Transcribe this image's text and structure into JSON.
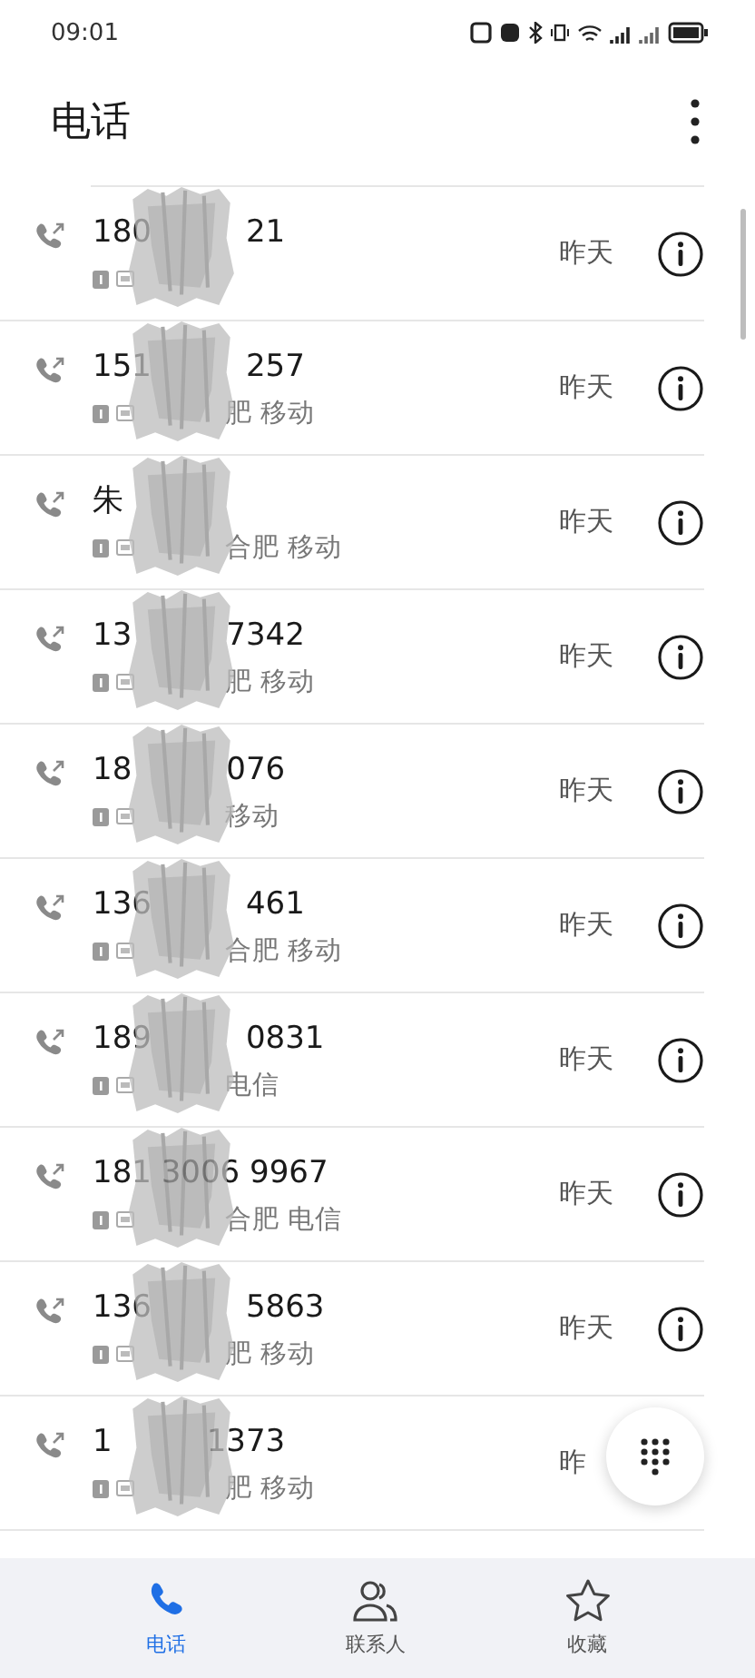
{
  "status_bar": {
    "time": "09:01"
  },
  "header": {
    "title": "电话"
  },
  "calls": [
    {
      "number_start": "180",
      "number_end": "21",
      "date": "昨天",
      "info": true
    },
    {
      "number_start": "151",
      "number_end": "257",
      "location": "肥 移动",
      "date": "昨天",
      "info": true
    },
    {
      "number_start": "朱",
      "location": "合肥 移动",
      "date": "昨天",
      "info": true
    },
    {
      "number_start": "13",
      "number_end": "7342",
      "location": "肥 移动",
      "date": "昨天",
      "info": true
    },
    {
      "number_start": "18",
      "number_end": "076",
      "location": "移动",
      "date": "昨天",
      "info": true
    },
    {
      "number_start": "136",
      "number_end": "461",
      "location": "合肥 移动",
      "date": "昨天",
      "info": true
    },
    {
      "number_start": "189",
      "number_end": "0831",
      "location": "电信",
      "date": "昨天",
      "info": true
    },
    {
      "number_start": "181 3006 9967",
      "location": "合肥 电信",
      "date": "昨天",
      "info": true
    },
    {
      "number_start": "136",
      "number_end": "5863",
      "location": "肥 移动",
      "date": "昨天",
      "info": true
    },
    {
      "number_start": "1",
      "number_end": "1373",
      "location": "肥 移动",
      "date": "昨",
      "info": false
    }
  ],
  "bottom_nav": [
    {
      "kind": "phone",
      "label": "电话",
      "selected": true
    },
    {
      "kind": "contacts",
      "label": "联系人",
      "selected": false
    },
    {
      "kind": "star",
      "label": "收藏",
      "selected": false
    }
  ]
}
